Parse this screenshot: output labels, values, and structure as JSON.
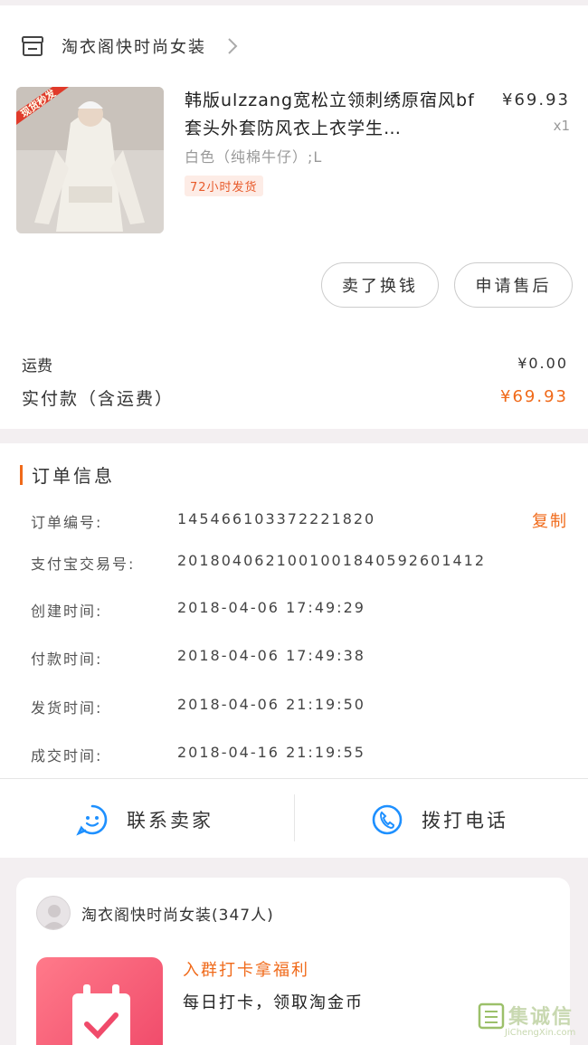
{
  "shop": {
    "name": "淘衣阁快时尚女装",
    "icon": "store-icon"
  },
  "item": {
    "title": "韩版ulzzang宽松立领刺绣原宿风bf套头外套防风衣上衣学生…",
    "sku": "白色（纯棉牛仔）;L",
    "badge": "72小时发货",
    "price": "¥69.93",
    "qty": "x1",
    "thumb_badge": "现货秒发"
  },
  "buttons": {
    "sell": "卖了换钱",
    "after_sale": "申请售后"
  },
  "fees": {
    "shipping_label": "运费",
    "shipping_value": "¥0.00",
    "paid_label": "实付款（含运费）",
    "paid_value": "¥69.93"
  },
  "order": {
    "title": "订单信息",
    "copy": "复制",
    "rows": [
      {
        "k": "订单编号:",
        "v": "145466103372221820"
      },
      {
        "k": "支付宝交易号:",
        "v": "2018040621001001840592601412"
      },
      {
        "k": "创建时间:",
        "v": "2018-04-06 17:49:29"
      },
      {
        "k": "付款时间:",
        "v": "2018-04-06 17:49:38"
      },
      {
        "k": "发货时间:",
        "v": "2018-04-06 21:19:50"
      },
      {
        "k": "成交时间:",
        "v": "2018-04-16 21:19:55"
      }
    ]
  },
  "actions": {
    "contact": "联系卖家",
    "call": "拨打电话"
  },
  "group": {
    "name": "淘衣阁快时尚女装(347人)",
    "promo_title": "入群打卡拿福利",
    "promo_sub": "每日打卡，领取淘金币"
  },
  "watermark": {
    "text": "集诚信",
    "sub": "JiChengXin.com"
  },
  "colors": {
    "accent": "#f06a1a",
    "blue": "#1e90ff",
    "background": "#f3eff1"
  }
}
